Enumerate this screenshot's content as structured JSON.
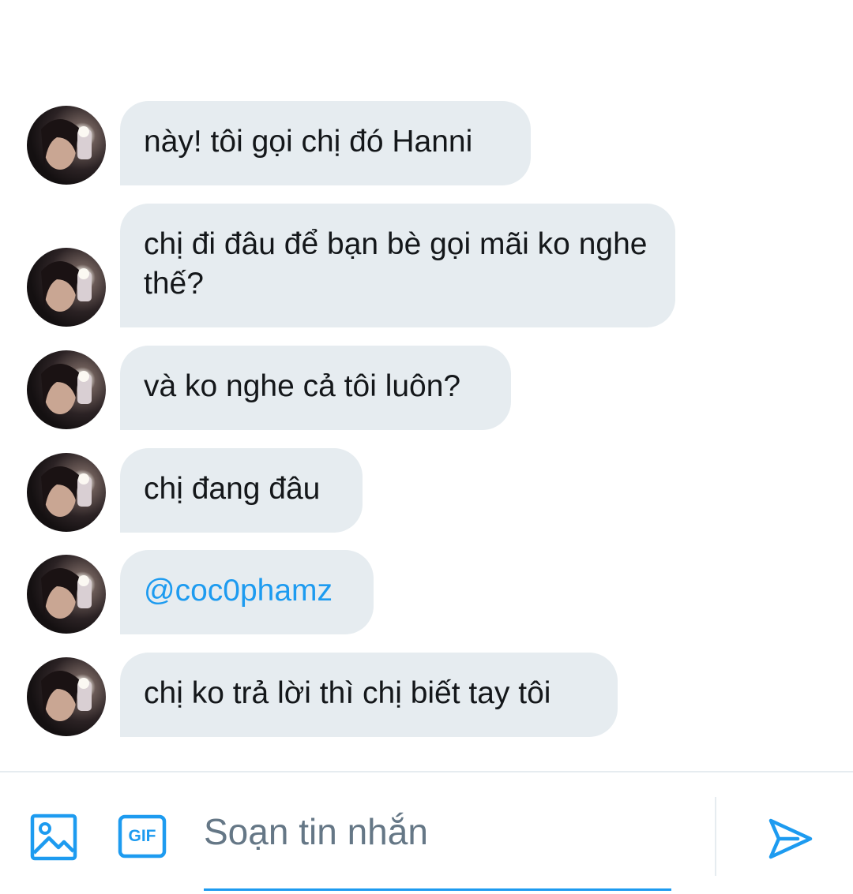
{
  "conversation": {
    "messages": [
      {
        "text": "này! tôi gọi chị đó Hanni",
        "type": "text"
      },
      {
        "text": "chị đi đâu để bạn bè gọi mãi ko nghe thế?",
        "type": "text"
      },
      {
        "text": "và ko nghe cả tôi luôn?",
        "type": "text"
      },
      {
        "text": "chị đang đâu",
        "type": "text"
      },
      {
        "text": "@coc0phamz",
        "type": "mention"
      },
      {
        "text": "chị ko trả lời thì chị biết tay tôi",
        "type": "text"
      }
    ]
  },
  "composer": {
    "placeholder": "Soạn tin nhắn",
    "value": "",
    "gif_label": "GIF",
    "icons": [
      "image-icon",
      "gif-icon",
      "send-icon"
    ]
  },
  "colors": {
    "accent": "#1d9bf0",
    "bubble_bg": "#e6ecf0",
    "text": "#14171a",
    "placeholder": "#657786"
  }
}
